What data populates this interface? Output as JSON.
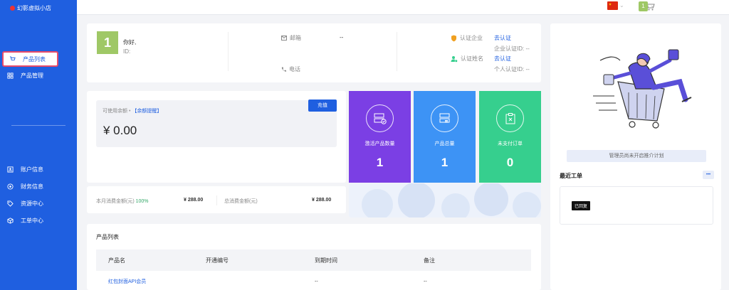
{
  "brand": {
    "name": "幻影虚拟小店"
  },
  "sidebar": {
    "items": [
      {
        "label": "产品列表",
        "icon": "cart-icon",
        "active": true
      },
      {
        "label": "产品管理",
        "icon": "grid-icon"
      },
      {
        "label": "账户信息",
        "icon": "account-icon"
      },
      {
        "label": "财务信息",
        "icon": "finance-icon"
      },
      {
        "label": "资源中心",
        "icon": "tag-icon"
      },
      {
        "label": "工单中心",
        "icon": "cube-icon"
      }
    ]
  },
  "topbar": {
    "avatar_initial": "1",
    "flag_icon": "china-flag-icon"
  },
  "profile": {
    "avatar_initial": "1",
    "greeting": "你好,",
    "id_label": "ID:",
    "email_label": "邮箱",
    "email_value": "--",
    "phone_label": "电话",
    "company_cert_label": "认证企业",
    "company_cert_link": "去认证",
    "company_cert_id": "企业认证ID: --",
    "personal_cert_label": "认证姓名",
    "personal_cert_link": "去认证",
    "personal_cert_id": "个人认证ID: --"
  },
  "balance": {
    "label": "可使用余额",
    "reminder_link": "【余额提醒】",
    "charge_button": "充值",
    "amount": "¥ 0.00",
    "month_spend_label": "本月消费金额(元)",
    "month_spend_pct": "100%",
    "month_spend_value": "¥ 288.00",
    "total_spend_label": "总消费金额(元)",
    "total_spend_value": "¥ 288.00"
  },
  "stats": [
    {
      "label": "激活产品数量",
      "value": "1",
      "color": "#7b3fe4"
    },
    {
      "label": "产品总量",
      "value": "1",
      "color": "#3d93f5"
    },
    {
      "label": "未支付订单",
      "value": "0",
      "color": "#36cf8e"
    }
  ],
  "promo": {
    "notice": "管理员尚未开启推介计划"
  },
  "tickets": {
    "title": "最近工单",
    "more": "•••",
    "badge": "已回复"
  },
  "products": {
    "title": "产品列表",
    "columns": [
      "产品名",
      "开通编号",
      "到期时间",
      "备注"
    ],
    "rows": [
      {
        "name": "红包封面API会员",
        "number": "",
        "expire": "--",
        "note": "--"
      }
    ]
  }
}
